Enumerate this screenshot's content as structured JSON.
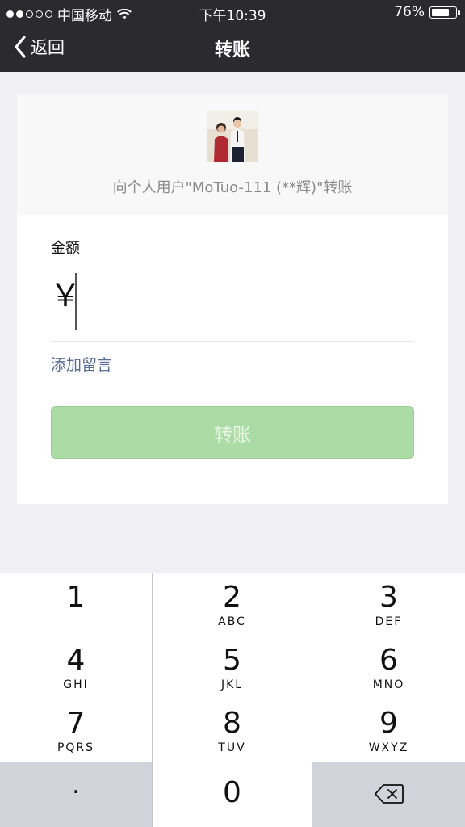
{
  "status_bar": {
    "carrier": "中国移动",
    "time": "下午10:39",
    "battery_percent": "76%",
    "signal_icon": "signal-dots-icon",
    "wifi_icon": "wifi-icon",
    "battery_icon": "battery-icon"
  },
  "nav": {
    "back_label": "返回",
    "title": "转账"
  },
  "recipient": {
    "text": "向个人用户\"MoTuo-111 (**辉)\"转账"
  },
  "amount": {
    "label": "金额",
    "currency": "￥",
    "value": ""
  },
  "add_note_label": "添加留言",
  "transfer_button_label": "转账",
  "keypad": {
    "keys": [
      {
        "num": "1",
        "letters": ""
      },
      {
        "num": "2",
        "letters": "ABC"
      },
      {
        "num": "3",
        "letters": "DEF"
      },
      {
        "num": "4",
        "letters": "GHI"
      },
      {
        "num": "5",
        "letters": "JKL"
      },
      {
        "num": "6",
        "letters": "MNO"
      },
      {
        "num": "7",
        "letters": "PQRS"
      },
      {
        "num": "8",
        "letters": "TUV"
      },
      {
        "num": "9",
        "letters": "WXYZ"
      },
      {
        "num": ".",
        "letters": ""
      },
      {
        "num": "0",
        "letters": ""
      }
    ]
  },
  "colors": {
    "nav_bg": "#2b2b2f",
    "page_bg": "#efeff4",
    "link_blue": "#576b95",
    "button_green_disabled": "#acdca5"
  }
}
